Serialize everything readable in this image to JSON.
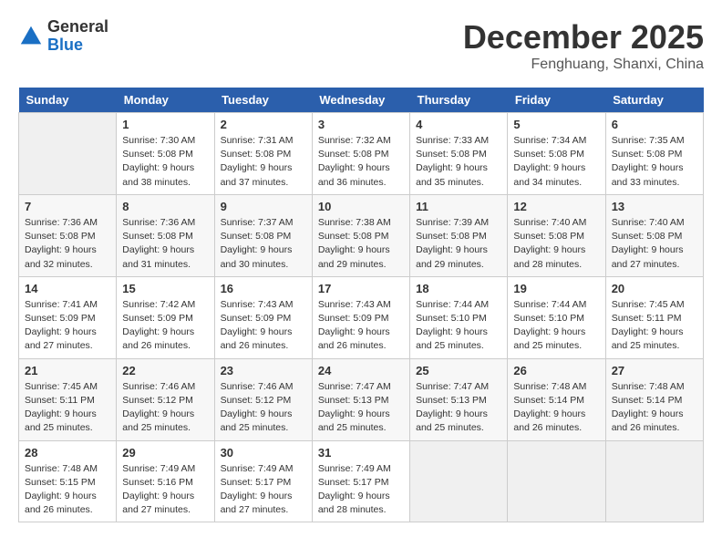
{
  "logo": {
    "line1": "General",
    "line2": "Blue"
  },
  "title": "December 2025",
  "subtitle": "Fenghuang, Shanxi, China",
  "days_header": [
    "Sunday",
    "Monday",
    "Tuesday",
    "Wednesday",
    "Thursday",
    "Friday",
    "Saturday"
  ],
  "weeks": [
    [
      {
        "num": "",
        "info": ""
      },
      {
        "num": "1",
        "info": "Sunrise: 7:30 AM\nSunset: 5:08 PM\nDaylight: 9 hours\nand 38 minutes."
      },
      {
        "num": "2",
        "info": "Sunrise: 7:31 AM\nSunset: 5:08 PM\nDaylight: 9 hours\nand 37 minutes."
      },
      {
        "num": "3",
        "info": "Sunrise: 7:32 AM\nSunset: 5:08 PM\nDaylight: 9 hours\nand 36 minutes."
      },
      {
        "num": "4",
        "info": "Sunrise: 7:33 AM\nSunset: 5:08 PM\nDaylight: 9 hours\nand 35 minutes."
      },
      {
        "num": "5",
        "info": "Sunrise: 7:34 AM\nSunset: 5:08 PM\nDaylight: 9 hours\nand 34 minutes."
      },
      {
        "num": "6",
        "info": "Sunrise: 7:35 AM\nSunset: 5:08 PM\nDaylight: 9 hours\nand 33 minutes."
      }
    ],
    [
      {
        "num": "7",
        "info": "Sunrise: 7:36 AM\nSunset: 5:08 PM\nDaylight: 9 hours\nand 32 minutes."
      },
      {
        "num": "8",
        "info": "Sunrise: 7:36 AM\nSunset: 5:08 PM\nDaylight: 9 hours\nand 31 minutes."
      },
      {
        "num": "9",
        "info": "Sunrise: 7:37 AM\nSunset: 5:08 PM\nDaylight: 9 hours\nand 30 minutes."
      },
      {
        "num": "10",
        "info": "Sunrise: 7:38 AM\nSunset: 5:08 PM\nDaylight: 9 hours\nand 29 minutes."
      },
      {
        "num": "11",
        "info": "Sunrise: 7:39 AM\nSunset: 5:08 PM\nDaylight: 9 hours\nand 29 minutes."
      },
      {
        "num": "12",
        "info": "Sunrise: 7:40 AM\nSunset: 5:08 PM\nDaylight: 9 hours\nand 28 minutes."
      },
      {
        "num": "13",
        "info": "Sunrise: 7:40 AM\nSunset: 5:08 PM\nDaylight: 9 hours\nand 27 minutes."
      }
    ],
    [
      {
        "num": "14",
        "info": "Sunrise: 7:41 AM\nSunset: 5:09 PM\nDaylight: 9 hours\nand 27 minutes."
      },
      {
        "num": "15",
        "info": "Sunrise: 7:42 AM\nSunset: 5:09 PM\nDaylight: 9 hours\nand 26 minutes."
      },
      {
        "num": "16",
        "info": "Sunrise: 7:43 AM\nSunset: 5:09 PM\nDaylight: 9 hours\nand 26 minutes."
      },
      {
        "num": "17",
        "info": "Sunrise: 7:43 AM\nSunset: 5:09 PM\nDaylight: 9 hours\nand 26 minutes."
      },
      {
        "num": "18",
        "info": "Sunrise: 7:44 AM\nSunset: 5:10 PM\nDaylight: 9 hours\nand 25 minutes."
      },
      {
        "num": "19",
        "info": "Sunrise: 7:44 AM\nSunset: 5:10 PM\nDaylight: 9 hours\nand 25 minutes."
      },
      {
        "num": "20",
        "info": "Sunrise: 7:45 AM\nSunset: 5:11 PM\nDaylight: 9 hours\nand 25 minutes."
      }
    ],
    [
      {
        "num": "21",
        "info": "Sunrise: 7:45 AM\nSunset: 5:11 PM\nDaylight: 9 hours\nand 25 minutes."
      },
      {
        "num": "22",
        "info": "Sunrise: 7:46 AM\nSunset: 5:12 PM\nDaylight: 9 hours\nand 25 minutes."
      },
      {
        "num": "23",
        "info": "Sunrise: 7:46 AM\nSunset: 5:12 PM\nDaylight: 9 hours\nand 25 minutes."
      },
      {
        "num": "24",
        "info": "Sunrise: 7:47 AM\nSunset: 5:13 PM\nDaylight: 9 hours\nand 25 minutes."
      },
      {
        "num": "25",
        "info": "Sunrise: 7:47 AM\nSunset: 5:13 PM\nDaylight: 9 hours\nand 25 minutes."
      },
      {
        "num": "26",
        "info": "Sunrise: 7:48 AM\nSunset: 5:14 PM\nDaylight: 9 hours\nand 26 minutes."
      },
      {
        "num": "27",
        "info": "Sunrise: 7:48 AM\nSunset: 5:14 PM\nDaylight: 9 hours\nand 26 minutes."
      }
    ],
    [
      {
        "num": "28",
        "info": "Sunrise: 7:48 AM\nSunset: 5:15 PM\nDaylight: 9 hours\nand 26 minutes."
      },
      {
        "num": "29",
        "info": "Sunrise: 7:49 AM\nSunset: 5:16 PM\nDaylight: 9 hours\nand 27 minutes."
      },
      {
        "num": "30",
        "info": "Sunrise: 7:49 AM\nSunset: 5:17 PM\nDaylight: 9 hours\nand 27 minutes."
      },
      {
        "num": "31",
        "info": "Sunrise: 7:49 AM\nSunset: 5:17 PM\nDaylight: 9 hours\nand 28 minutes."
      },
      {
        "num": "",
        "info": ""
      },
      {
        "num": "",
        "info": ""
      },
      {
        "num": "",
        "info": ""
      }
    ]
  ]
}
